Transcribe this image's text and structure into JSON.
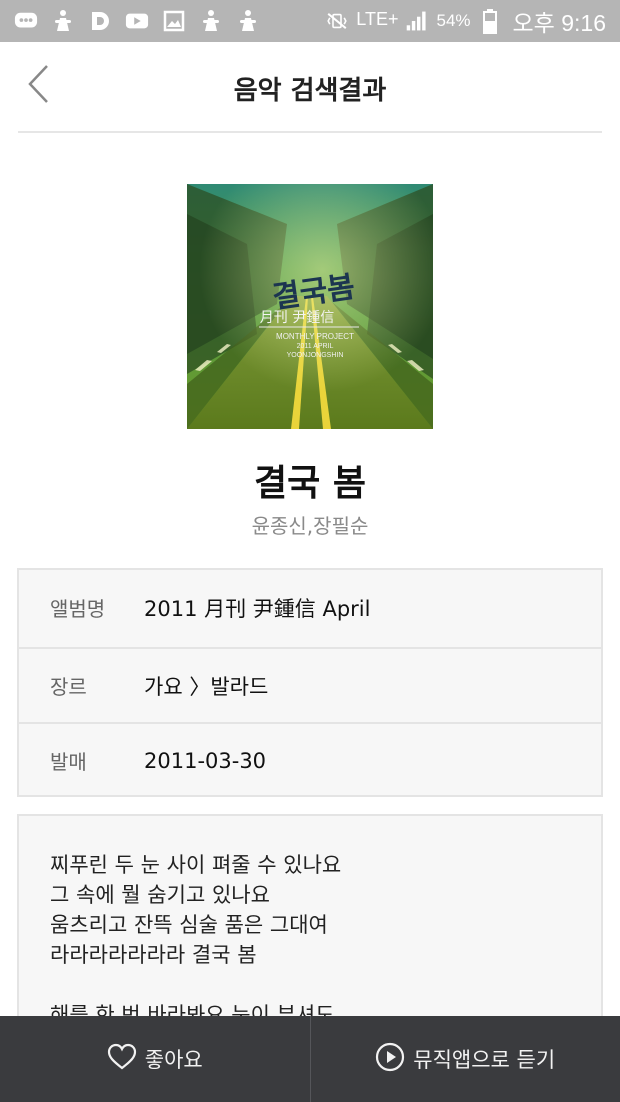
{
  "status_bar": {
    "network": "LTE+",
    "battery": "54%",
    "time": "오후 9:16"
  },
  "header": {
    "title": "음악 검색결과"
  },
  "song": {
    "title": "결국 봄",
    "artist": "윤종신,장필순",
    "cover_title": "결국봄",
    "cover_subtitle": "月刊 尹鍾信",
    "cover_project": "MONTHLY PROJECT",
    "cover_date": "2011 APRIL",
    "cover_name": "YOONJONGSHIN"
  },
  "info": [
    {
      "label": "앨범명",
      "value": "2011 月刊 尹鍾信 April"
    },
    {
      "label": "장르",
      "value": "가요 〉발라드"
    },
    {
      "label": "발매",
      "value": "2011-03-30"
    }
  ],
  "lyrics": {
    "lines": [
      "찌푸린 두 눈 사이 펴줄 수 있나요",
      "그 속에 뭘 숨기고 있나요",
      "움츠리고 잔뜩 심술 품은 그대여",
      "라라라라라라라 결국 봄",
      "",
      "해를 한 번 바라봐요 눈이 부셔도"
    ]
  },
  "bottom_bar": {
    "like_label": "좋아요",
    "listen_label": "뮤직앱으로 듣기"
  },
  "colors": {
    "status_bar": "#b5b5b5",
    "bottom_bar": "#3a3b3e",
    "box_bg": "#f7f7f7",
    "border": "#e4e4e4"
  },
  "icons": {
    "back": "chevron-left-icon",
    "like": "heart-icon",
    "listen": "play-circle-icon"
  }
}
